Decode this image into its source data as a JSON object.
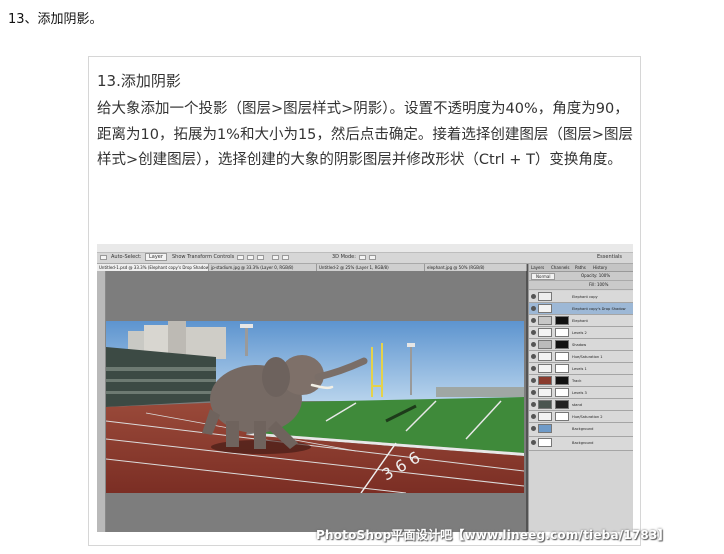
{
  "step_heading": "13、添加阴影。",
  "card": {
    "title": "13.添加阴影",
    "paragraph": "给大象添加一个投影（图层>图层样式>阴影）。设置不透明度为40%，角度为90，距离为10，拓展为1%和大小为15，然后点击确定。接着选择创建图层（图层>图层样式>创建图层），选择创建的大象的阴影图层并修改形状（Ctrl + T）变换角度。"
  },
  "photoshop": {
    "options_bar": {
      "auto_select_label": "Auto-Select:",
      "layer_dropdown": "Layer",
      "transform_label": "Show Transform Controls",
      "mode_label": "3D Mode:",
      "workspace": "Essentials"
    },
    "document_tabs": [
      "Untitled-1.psd @ 33.3% (Elephant copy's Drop Shadow, RGB/8)",
      "jp-stadium.jpg @ 33.3% (Layer 0, RGB/8)",
      "Untitled-2 @ 25% (Layer 1, RGB/8)",
      "elephant.jpg @ 50% (RGB/8)"
    ],
    "panel_tabs": [
      "Layers",
      "Channels",
      "Paths",
      "History"
    ],
    "panel_blend": "Normal",
    "panel_opacity": "Opacity: 100%",
    "panel_fill": "Fill: 100%",
    "layers": [
      {
        "name": "Elephant copy",
        "selected": false
      },
      {
        "name": "Elephant copy's Drop Shadow",
        "selected": true
      },
      {
        "name": "Elephant",
        "selected": false
      },
      {
        "name": "Levels 2",
        "selected": false
      },
      {
        "name": "Shadow",
        "selected": false
      },
      {
        "name": "Hue/Saturation 1",
        "selected": false
      },
      {
        "name": "Levels 1",
        "selected": false
      },
      {
        "name": "Track",
        "selected": false
      },
      {
        "name": "Levels 3",
        "selected": false
      },
      {
        "name": "stand",
        "selected": false
      },
      {
        "name": "Hue/Saturation 2",
        "selected": false
      },
      {
        "name": "Background",
        "selected": false
      },
      {
        "name": "Background",
        "selected": false
      }
    ]
  },
  "watermark": "PhotoShop平面设计吧【www.lineeg.com/tieba/1783】"
}
